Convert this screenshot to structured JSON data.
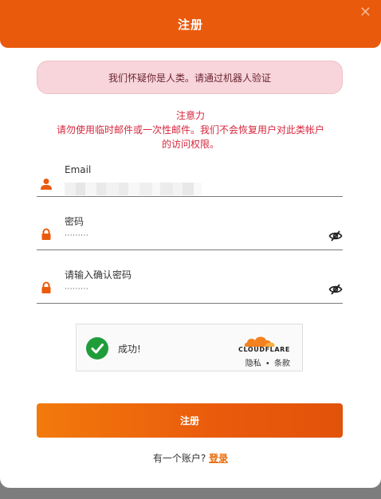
{
  "header": {
    "title": "注册",
    "close_icon": "close-icon"
  },
  "captcha_warning": "我们怀疑你是人类。请通过机器人验证",
  "notice": {
    "title": "注意力",
    "body_line1": "请勿使用临时邮件或一次性邮件。我们不会恢复用户对此类帐户",
    "body_line2": "的访问权限。"
  },
  "form": {
    "email": {
      "label": "Email",
      "icon": "user-icon"
    },
    "password": {
      "label": "密码",
      "value": "·········",
      "icon": "lock-icon",
      "toggle_icon": "eye-slash-icon"
    },
    "confirm_password": {
      "label": "请输入确认密码",
      "value": "·········",
      "icon": "lock-icon",
      "toggle_icon": "eye-slash-icon"
    }
  },
  "cloudflare": {
    "status": "成功!",
    "brand": "CLOUDFLARE",
    "privacy": "隐私",
    "separator": "•",
    "terms": "条款"
  },
  "submit_label": "注册",
  "footer": {
    "question": "有一个账户?",
    "login_link": "登录"
  },
  "colors": {
    "accent": "#ea5a0c",
    "warning_bg": "#f7d5da",
    "notice_text": "#d7263d",
    "success": "#1f9d3a",
    "cloudflare_orange": "#f48120"
  }
}
